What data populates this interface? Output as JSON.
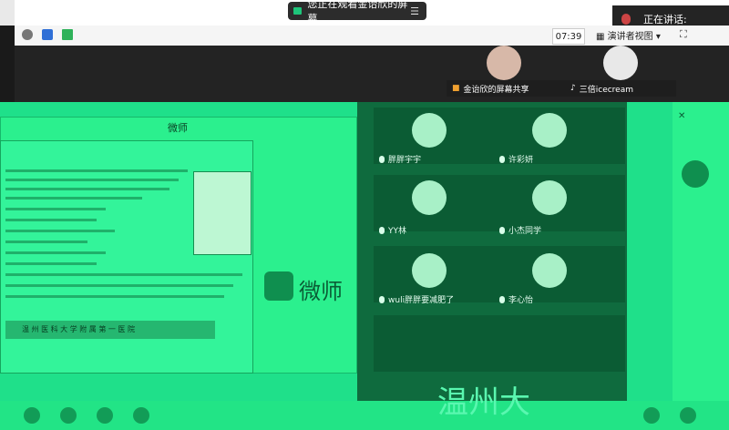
{
  "top": {
    "notice": "您正在观看金诒欣的屏幕",
    "speaking": "正在讲话:",
    "clock": "07:39",
    "presenter_view": "演讲者视图"
  },
  "participants_top": [
    {
      "name": "金诒欣的屏幕共享"
    },
    {
      "name": "三倍icecream"
    }
  ],
  "slide": {
    "title": "微师",
    "doc_caption": "温 州 医 科 大 学 附 属 第 一 医 院",
    "logo": "微师"
  },
  "grid": [
    {
      "name": "胖胖宇宇"
    },
    {
      "name": "许彩妍"
    },
    {
      "name": "YY林"
    },
    {
      "name": "小杰同学"
    },
    {
      "name": "wuli胖胖要减肥了"
    },
    {
      "name": "李心怡"
    }
  ],
  "watermark": "温州大",
  "colors": {
    "overlay": "#1fe08a",
    "dark": "#232323"
  }
}
